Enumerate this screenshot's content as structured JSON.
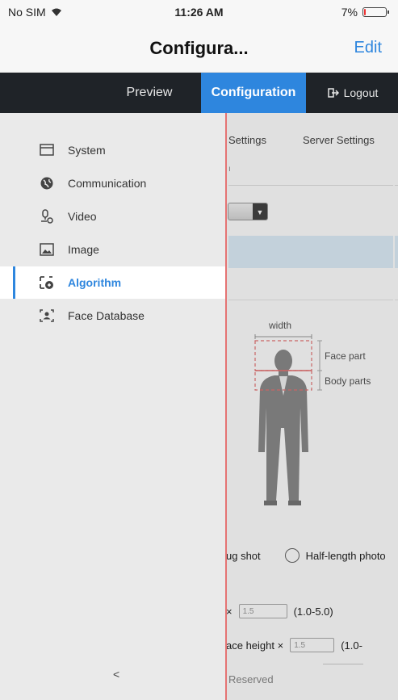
{
  "status": {
    "carrier": "No SIM",
    "time": "11:26 AM",
    "battery": "7%",
    "battery_level": 0.07
  },
  "nav": {
    "title": "Configura...",
    "edit": "Edit"
  },
  "tabs": {
    "preview": "Preview",
    "configuration": "Configuration",
    "logout": "Logout"
  },
  "subtabs": {
    "settings": "Settings",
    "server_settings": "Server Settings",
    "fragment": "ı"
  },
  "sidebar": {
    "items": [
      {
        "label": "System",
        "icon": "window-icon"
      },
      {
        "label": "Communication",
        "icon": "globe-icon"
      },
      {
        "label": "Video",
        "icon": "camera-icon"
      },
      {
        "label": "Image",
        "icon": "image-icon"
      },
      {
        "label": "Algorithm",
        "icon": "algorithm-icon",
        "active": true
      },
      {
        "label": "Face Database",
        "icon": "face-frame-icon"
      }
    ],
    "collapse": "<"
  },
  "figure": {
    "width_label": "width",
    "face_label": "Face part",
    "body_label": "Body parts"
  },
  "shot": {
    "mug": "ug shot",
    "half": "Half-length photo"
  },
  "params": {
    "row1_prefix": "×",
    "row1_value": "1.5",
    "row1_range": "(1.0-5.0)",
    "row2_prefix": "ace height ×",
    "row2_value": "1.5",
    "row2_range": "(1.0-",
    "reserved": "Reserved"
  },
  "colors": {
    "accent": "#2e86de",
    "tab_bar": "#1f2328",
    "divider": "#e57373"
  }
}
